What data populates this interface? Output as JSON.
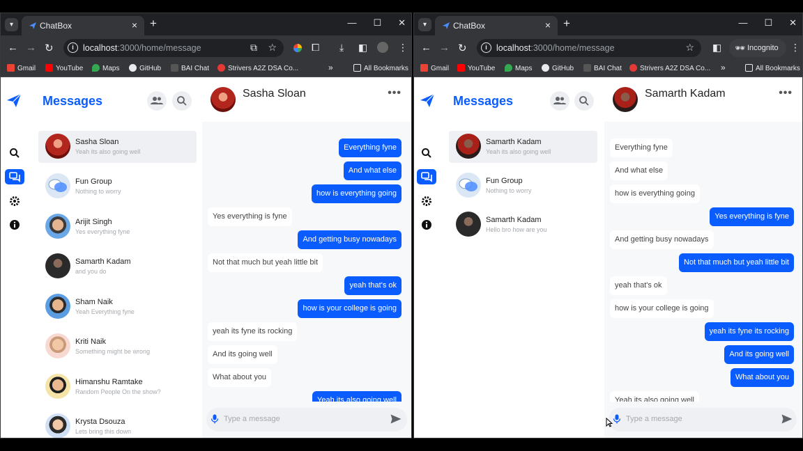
{
  "browser": {
    "tab_title": "ChatBox",
    "url_host": "localhost",
    "url_path": ":3000/home/message",
    "incognito_label": "Incognito",
    "bookmarks": [
      "Gmail",
      "YouTube",
      "Maps",
      "GitHub",
      "BAI Chat",
      "Strivers A2Z DSA Co..."
    ],
    "all_bookmarks": "All Bookmarks"
  },
  "app": {
    "title": "Messages",
    "accent_color": "#0b5cff",
    "input_placeholder": "Type a message"
  },
  "left": {
    "conversations": [
      {
        "name": "Sasha Sloan",
        "preview": "Yeah its also going well"
      },
      {
        "name": "Fun Group",
        "preview": "Nothing to worry"
      },
      {
        "name": "Arijit Singh",
        "preview": "Yes everything fyne"
      },
      {
        "name": "Samarth Kadam",
        "preview": "and you do"
      },
      {
        "name": "Sham Naik",
        "preview": "Yeah Everything fyne"
      },
      {
        "name": "Kriti Naik",
        "preview": "Something might be wrong"
      },
      {
        "name": "Himanshu Ramtake",
        "preview": "Random People On the show?"
      },
      {
        "name": "Krysta Dsouza",
        "preview": "Lets bring this down"
      }
    ],
    "chat_name": "Sasha Sloan",
    "messages": [
      {
        "text": "Everything fyne",
        "dir": "out"
      },
      {
        "text": "And what else",
        "dir": "out"
      },
      {
        "text": "how is everything going",
        "dir": "out"
      },
      {
        "text": "Yes everything is fyne",
        "dir": "in"
      },
      {
        "text": "And getting busy nowadays",
        "dir": "out"
      },
      {
        "text": "Not that much but yeah little bit",
        "dir": "in"
      },
      {
        "text": "yeah that's ok",
        "dir": "out"
      },
      {
        "text": "how is your college is going",
        "dir": "out"
      },
      {
        "text": "yeah its fyne its rocking",
        "dir": "in"
      },
      {
        "text": "And its going well",
        "dir": "in"
      },
      {
        "text": "What about you",
        "dir": "in"
      },
      {
        "text": "Yeah its also going well",
        "dir": "out"
      }
    ]
  },
  "right": {
    "conversations": [
      {
        "name": "Samarth Kadam",
        "preview": "Yeah its also going well"
      },
      {
        "name": "Fun Group",
        "preview": "Nothing to worry"
      },
      {
        "name": "Samarth Kadam",
        "preview": "Hello bro how are you"
      }
    ],
    "chat_name": "Samarth Kadam",
    "messages": [
      {
        "text": "Everything fyne",
        "dir": "in"
      },
      {
        "text": "And what else",
        "dir": "in"
      },
      {
        "text": "how is everything going",
        "dir": "in"
      },
      {
        "text": "Yes everything is fyne",
        "dir": "out"
      },
      {
        "text": "And getting busy nowadays",
        "dir": "in"
      },
      {
        "text": "Not that much but yeah little bit",
        "dir": "out"
      },
      {
        "text": "yeah that's ok",
        "dir": "in"
      },
      {
        "text": "how is your college is going",
        "dir": "in"
      },
      {
        "text": "yeah its fyne its rocking",
        "dir": "out"
      },
      {
        "text": "And its going well",
        "dir": "out"
      },
      {
        "text": "What about you",
        "dir": "out"
      },
      {
        "text": "Yeah its also going well",
        "dir": "in"
      }
    ]
  }
}
